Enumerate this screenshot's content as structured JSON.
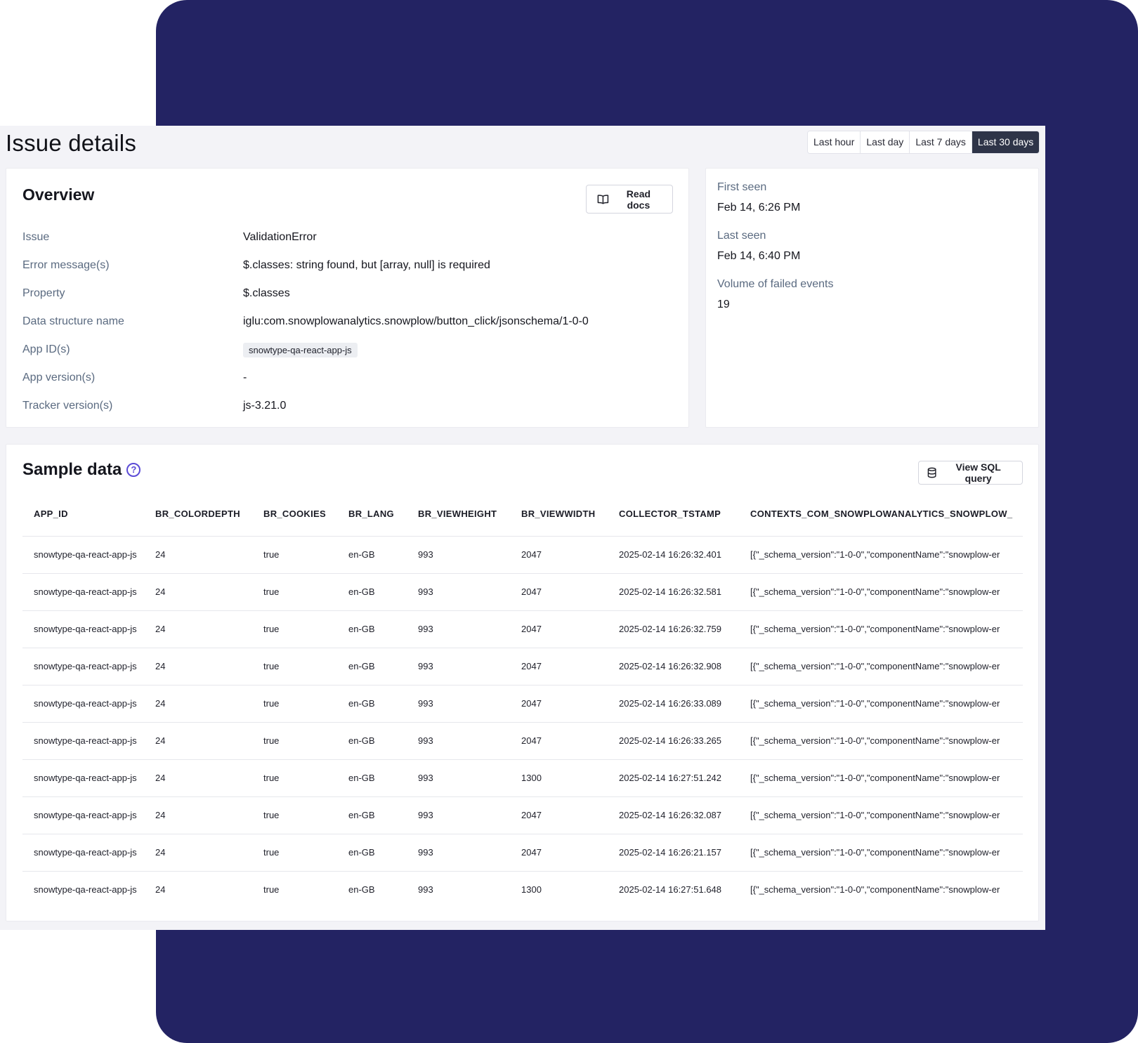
{
  "page": {
    "title": "Issue details"
  },
  "time_range": {
    "options": [
      "Last hour",
      "Last day",
      "Last 7 days",
      "Last 30 days"
    ],
    "selected": "Last 30 days"
  },
  "overview": {
    "title": "Overview",
    "read_docs_label": "Read docs",
    "fields": [
      {
        "key": "Issue",
        "value": "ValidationError"
      },
      {
        "key": "Error message(s)",
        "value": "$.classes: string found, but [array, null] is required"
      },
      {
        "key": "Property",
        "value": "$.classes"
      },
      {
        "key": "Data structure name",
        "value": "iglu:com.snowplowanalytics.snowplow/button_click/jsonschema/1-0-0"
      },
      {
        "key": "App ID(s)",
        "value": "snowtype-qa-react-app-js",
        "tag": true
      },
      {
        "key": "App version(s)",
        "value": "-"
      },
      {
        "key": "Tracker version(s)",
        "value": "js-3.21.0"
      }
    ]
  },
  "seen": {
    "first_seen_label": "First seen",
    "first_seen": "Feb 14, 6:26 PM",
    "last_seen_label": "Last seen",
    "last_seen": "Feb 14, 6:40 PM",
    "volume_label": "Volume of failed events",
    "volume": "19"
  },
  "sample": {
    "title": "Sample data",
    "view_sql_label": "View SQL query",
    "columns": [
      "APP_ID",
      "BR_COLORDEPTH",
      "BR_COOKIES",
      "BR_LANG",
      "BR_VIEWHEIGHT",
      "BR_VIEWWIDTH",
      "COLLECTOR_TSTAMP",
      "CONTEXTS_COM_SNOWPLOWANALYTICS_SNOWPLOW_"
    ],
    "rows": [
      [
        "snowtype-qa-react-app-js",
        "24",
        "true",
        "en-GB",
        "993",
        "2047",
        "2025-02-14 16:26:32.401",
        "[{\"_schema_version\":\"1-0-0\",\"componentName\":\"snowplow-er"
      ],
      [
        "snowtype-qa-react-app-js",
        "24",
        "true",
        "en-GB",
        "993",
        "2047",
        "2025-02-14 16:26:32.581",
        "[{\"_schema_version\":\"1-0-0\",\"componentName\":\"snowplow-er"
      ],
      [
        "snowtype-qa-react-app-js",
        "24",
        "true",
        "en-GB",
        "993",
        "2047",
        "2025-02-14 16:26:32.759",
        "[{\"_schema_version\":\"1-0-0\",\"componentName\":\"snowplow-er"
      ],
      [
        "snowtype-qa-react-app-js",
        "24",
        "true",
        "en-GB",
        "993",
        "2047",
        "2025-02-14 16:26:32.908",
        "[{\"_schema_version\":\"1-0-0\",\"componentName\":\"snowplow-er"
      ],
      [
        "snowtype-qa-react-app-js",
        "24",
        "true",
        "en-GB",
        "993",
        "2047",
        "2025-02-14 16:26:33.089",
        "[{\"_schema_version\":\"1-0-0\",\"componentName\":\"snowplow-er"
      ],
      [
        "snowtype-qa-react-app-js",
        "24",
        "true",
        "en-GB",
        "993",
        "2047",
        "2025-02-14 16:26:33.265",
        "[{\"_schema_version\":\"1-0-0\",\"componentName\":\"snowplow-er"
      ],
      [
        "snowtype-qa-react-app-js",
        "24",
        "true",
        "en-GB",
        "993",
        "1300",
        "2025-02-14 16:27:51.242",
        "[{\"_schema_version\":\"1-0-0\",\"componentName\":\"snowplow-er"
      ],
      [
        "snowtype-qa-react-app-js",
        "24",
        "true",
        "en-GB",
        "993",
        "2047",
        "2025-02-14 16:26:32.087",
        "[{\"_schema_version\":\"1-0-0\",\"componentName\":\"snowplow-er"
      ],
      [
        "snowtype-qa-react-app-js",
        "24",
        "true",
        "en-GB",
        "993",
        "2047",
        "2025-02-14 16:26:21.157",
        "[{\"_schema_version\":\"1-0-0\",\"componentName\":\"snowplow-er"
      ],
      [
        "snowtype-qa-react-app-js",
        "24",
        "true",
        "en-GB",
        "993",
        "1300",
        "2025-02-14 16:27:51.648",
        "[{\"_schema_version\":\"1-0-0\",\"componentName\":\"snowplow-er"
      ]
    ]
  },
  "colors": {
    "backdrop": "#232363",
    "panel": "#f3f3f7",
    "active_range": "#2e3448",
    "label_text": "#5a6a80",
    "help_accent": "#5b4bd6"
  },
  "icons": {
    "read_docs": "book-open-icon",
    "view_sql": "database-icon",
    "help": "question-circle-icon"
  }
}
